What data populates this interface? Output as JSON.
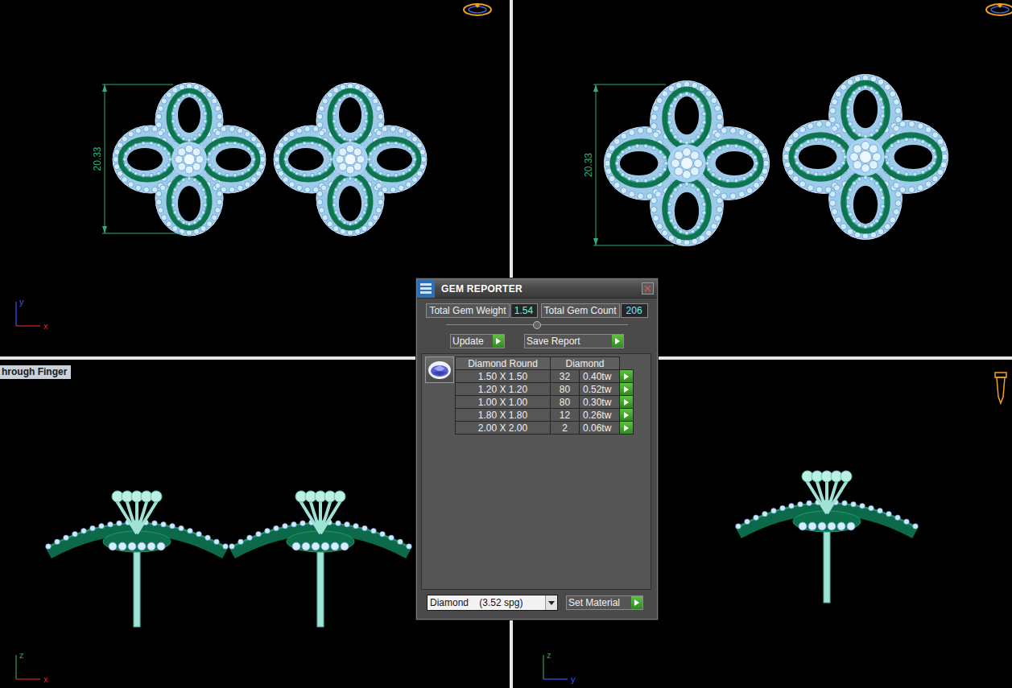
{
  "viewports": [
    {
      "kind": "plan",
      "dimension": "20.33",
      "axes": [
        {
          "label": "y",
          "color": "#3a55ff"
        },
        {
          "label": "x",
          "color": "#d02a2a"
        }
      ]
    },
    {
      "kind": "perspective",
      "dimension": "20.33"
    },
    {
      "kind": "side-pair",
      "label": "hrough Finger",
      "axes": [
        {
          "label": "z",
          "color": "#3a9a5a"
        },
        {
          "label": "x",
          "color": "#d02a2a"
        }
      ]
    },
    {
      "kind": "side-single",
      "axes": [
        {
          "label": "z",
          "color": "#3a9a5a"
        },
        {
          "label": "y",
          "color": "#3a55ff"
        }
      ]
    }
  ],
  "gem_reporter": {
    "title": "GEM REPORTER",
    "total_weight": {
      "label": "Total Gem Weight",
      "value": "1.54"
    },
    "total_count": {
      "label": "Total Gem Count",
      "value": "206"
    },
    "buttons": [
      "Update",
      "Save Report"
    ],
    "table": {
      "columns": [
        "Diamond Round",
        "Diamond"
      ],
      "rows": [
        {
          "size": "1.50 X 1.50",
          "count": "32",
          "weight": "0.40tw"
        },
        {
          "size": "1.20 X 1.20",
          "count": "80",
          "weight": "0.52tw"
        },
        {
          "size": "1.00 X 1.00",
          "count": "80",
          "weight": "0.30tw"
        },
        {
          "size": "1.80 X 1.80",
          "count": "12",
          "weight": "0.26tw"
        },
        {
          "size": "2.00 X 2.00",
          "count": "2",
          "weight": "0.06tw"
        }
      ]
    },
    "material": {
      "value": "Diamond    (3.52 spg)",
      "button": "Set Material"
    }
  }
}
